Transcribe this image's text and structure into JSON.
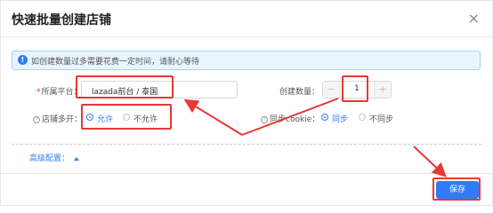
{
  "modal": {
    "title": "快速批量创建店铺",
    "close_glyph": "×"
  },
  "alert": {
    "icon": "!",
    "text": "如创建数量过多需要花费一定时间，请耐心等待"
  },
  "form": {
    "platform_label_required": "*",
    "platform_label": "所属平台：",
    "platform_value": "lazada前台 / 泰国",
    "count_label": "创建数量：",
    "count_value": "1",
    "count_minus": "−",
    "count_plus": "+",
    "multi_open_help": "?",
    "multi_open_label": "店铺多开：",
    "multi_open_options": [
      "允许",
      "不允许"
    ],
    "cookie_help": "?",
    "cookie_label": "同步cookie：",
    "cookie_options": [
      "同步",
      "不同步"
    ]
  },
  "advanced": {
    "label": "高级配置："
  },
  "footer": {
    "save_label": "保存"
  },
  "colors": {
    "accent": "#2f7cf6",
    "highlight": "#e53935"
  }
}
